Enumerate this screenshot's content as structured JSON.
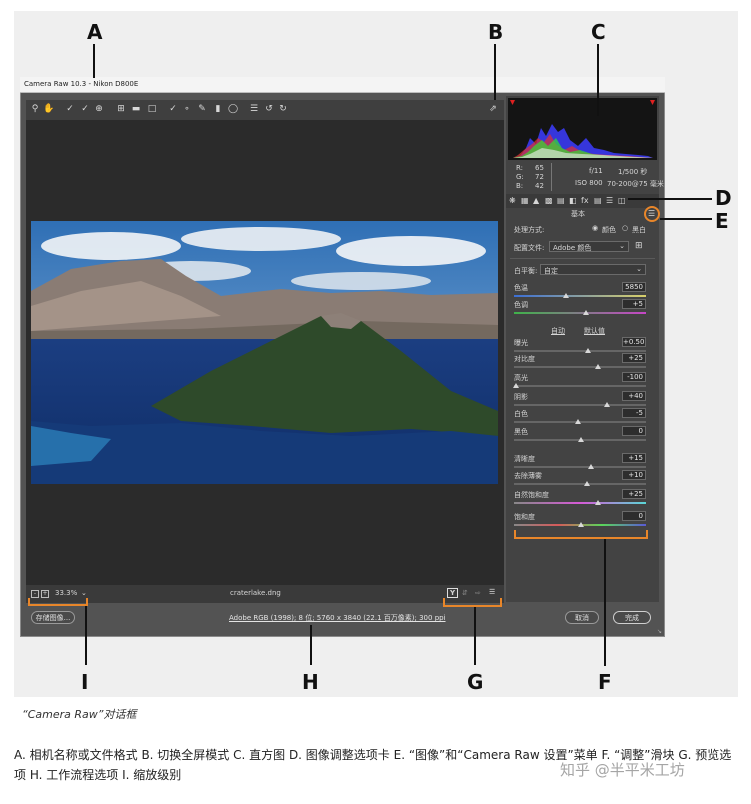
{
  "window": {
    "title": "Camera Raw 10.3 - Nikon D800E"
  },
  "callouts": {
    "A": "A",
    "B": "B",
    "C": "C",
    "D": "D",
    "E": "E",
    "F": "F",
    "G": "G",
    "H": "H",
    "I": "I"
  },
  "toolbar": {
    "tools": [
      "zoom-icon",
      "hand-icon",
      "white-balance-icon",
      "color-sampler-icon",
      "targeted-adjustment-icon",
      "crop-icon",
      "straighten-icon",
      "transform-icon",
      "spot-removal-icon",
      "red-eye-icon",
      "brush-icon",
      "graduated-filter-icon",
      "radial-filter-icon",
      "list-icon",
      "rotate-left-icon",
      "rotate-right-icon"
    ],
    "fullscreen_icon": "fullscreen-icon"
  },
  "histogram": {
    "readout": {
      "r_label": "R:",
      "r_value": "65",
      "g_label": "G:",
      "g_value": "72",
      "b_label": "B:",
      "b_value": "42",
      "aperture": "f/11",
      "shutter": "1/500 秒",
      "iso": "ISO 800",
      "lens": "70-200@75 毫米"
    }
  },
  "panel": {
    "tabs_icons": [
      "basic-tab-icon",
      "tone-curve-tab-icon",
      "detail-tab-icon",
      "hsl-tab-icon",
      "split-toning-tab-icon",
      "lens-tab-icon",
      "effects-tab-icon",
      "calibration-tab-icon",
      "presets-tab-icon",
      "snapshots-tab-icon"
    ],
    "title": "基本",
    "treatment_label": "处理方式:",
    "treatment_color": "颜色",
    "treatment_bw": "黑白",
    "profile_label": "配置文件:",
    "profile_value": "Adobe 颜色",
    "wb_label": "白平衡:",
    "wb_value": "自定",
    "auto_label": "自动",
    "default_label": "默认值",
    "sliders": [
      {
        "label": "色温",
        "value": "5850"
      },
      {
        "label": "色调",
        "value": "+5"
      },
      {
        "label": "曝光",
        "value": "+0.50"
      },
      {
        "label": "对比度",
        "value": "+25"
      },
      {
        "label": "高光",
        "value": "-100"
      },
      {
        "label": "阴影",
        "value": "+40"
      },
      {
        "label": "白色",
        "value": "-5"
      },
      {
        "label": "黑色",
        "value": "0"
      },
      {
        "label": "清晰度",
        "value": "+15"
      },
      {
        "label": "去除薄雾",
        "value": "+10"
      },
      {
        "label": "自然饱和度",
        "value": "+25"
      },
      {
        "label": "饱和度",
        "value": "0"
      }
    ]
  },
  "bottom": {
    "zoom": "33.3%",
    "filename": "craterlake.dng",
    "workflow": "Adobe RGB (1998); 8 位; 5760 x 3840 (22.1 百万像素); 300 ppi",
    "save_button": "存储图像...",
    "cancel_button": "取消",
    "done_button": "完成",
    "y_button": "Y"
  },
  "caption": "“Camera Raw”对话框",
  "legend": "A. 相机名称或文件格式 B. 切换全屏模式 C. 直方图 D. 图像调整选项卡 E. “图像”和“Camera Raw 设置”菜单 F. “调整”滑块 G. 预览选项 H. 工作流程选项 I. 缩放级别",
  "watermark": "知乎 @半平米工坊",
  "colors": {
    "accent_orange": "#e8862a",
    "window_gray": "#535353",
    "preview_dark": "#2b2b2b"
  }
}
